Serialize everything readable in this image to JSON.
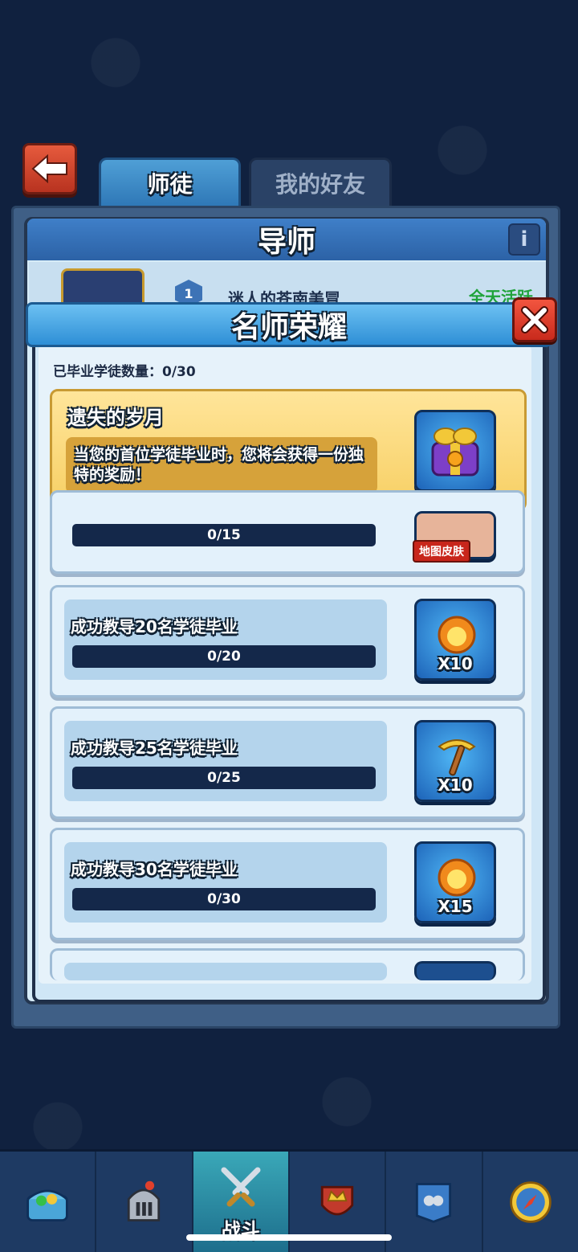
{
  "tabs": {
    "mentorship": "师徒",
    "friends": "我的好友"
  },
  "mentor_panel": {
    "title": "导师",
    "mentor_level": "1",
    "mentor_name": "迷人的苍南美冒",
    "mentor_status": "全天活跃"
  },
  "modal": {
    "title": "名师荣耀",
    "graduated_label": "已毕业学徒数量：0/30",
    "featured": {
      "title": "遗失的岁月",
      "description": "当您的首位学徒毕业时，您将会获得一份独特的奖励！"
    },
    "achievements": [
      {
        "label": "",
        "progress": "0/15",
        "reward_tag": "地图皮肤",
        "reward_qty": ""
      },
      {
        "label": "成功教导20名学徒毕业",
        "progress": "0/20",
        "reward_icon": "fire-orb-icon",
        "reward_qty": "X10"
      },
      {
        "label": "成功教导25名学徒毕业",
        "progress": "0/25",
        "reward_icon": "pickaxe-icon",
        "reward_qty": "X10"
      },
      {
        "label": "成功教导30名学徒毕业",
        "progress": "0/30",
        "reward_icon": "fire-orb-icon",
        "reward_qty": "X15"
      }
    ]
  },
  "bottom_nav": {
    "items": [
      {
        "icon": "treasure-chest-icon"
      },
      {
        "icon": "knight-helmet-icon"
      },
      {
        "icon": "crossed-swords-icon",
        "label": "战斗",
        "active": true
      },
      {
        "icon": "crown-shield-icon"
      },
      {
        "icon": "guild-banner-icon"
      },
      {
        "icon": "compass-icon"
      }
    ]
  },
  "colors": {
    "accent": "#2e8fd6",
    "close": "#e0402c",
    "gold": "#f7cf63",
    "background": "#10213f"
  }
}
